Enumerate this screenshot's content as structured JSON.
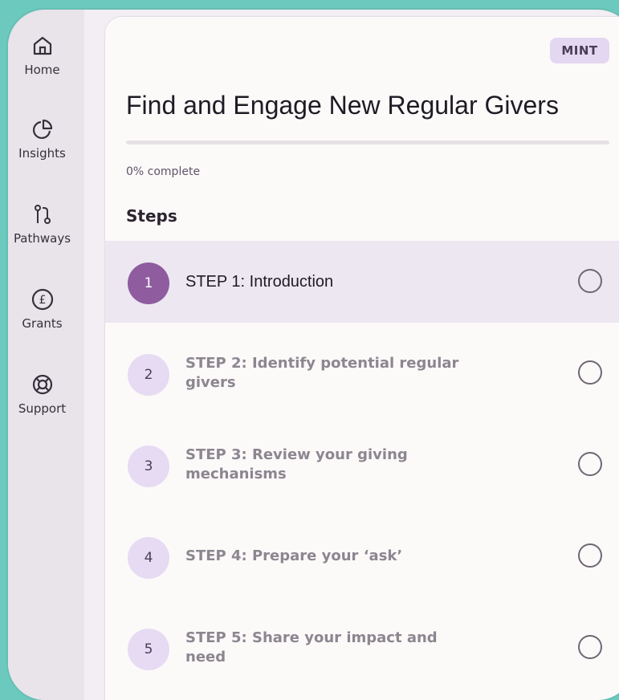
{
  "nav": [
    {
      "label": "Home",
      "icon": "home-icon"
    },
    {
      "label": "Insights",
      "icon": "pie-chart-icon"
    },
    {
      "label": "Pathways",
      "icon": "pathways-icon"
    },
    {
      "label": "Grants",
      "icon": "pound-coin-icon"
    },
    {
      "label": "Support",
      "icon": "lifebuoy-icon"
    }
  ],
  "badge": "MINT",
  "title": "Find and Engage New Regular Givers",
  "progress": {
    "percent": 0,
    "label": "0% complete"
  },
  "steps_heading": "Steps",
  "steps": [
    {
      "number": "1",
      "label": "STEP 1: Introduction",
      "active": true
    },
    {
      "number": "2",
      "label": "STEP 2: Identify potential regular givers",
      "active": false
    },
    {
      "number": "3",
      "label": "STEP 3: Review your giving mechanisms",
      "active": false
    },
    {
      "number": "4",
      "label": "STEP 4: Prepare your ‘ask’",
      "active": false
    },
    {
      "number": "5",
      "label": "STEP 5: Share your impact and need",
      "active": false
    }
  ],
  "colors": {
    "accent": "#8e5c9f",
    "badge_bg": "#e4d7f1",
    "active_row": "#ede7f1",
    "background": "#6cc9bd"
  }
}
